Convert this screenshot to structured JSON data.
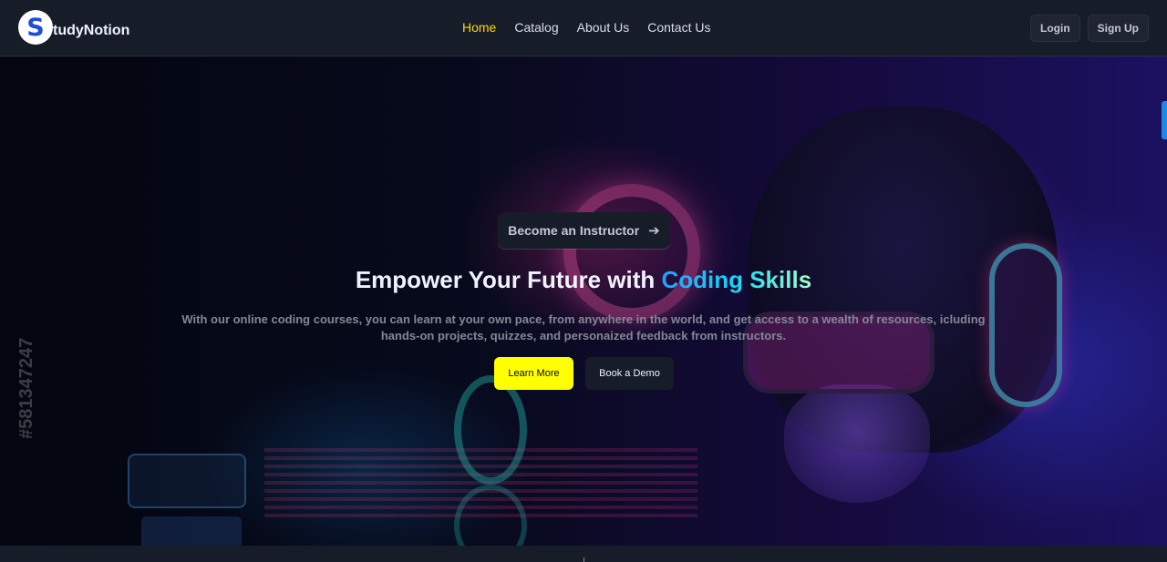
{
  "brand": {
    "logo_letter": "S",
    "name": "tudyNotion"
  },
  "nav": {
    "links": [
      {
        "label": "Home",
        "active": true
      },
      {
        "label": "Catalog",
        "active": false
      },
      {
        "label": "About Us",
        "active": false
      },
      {
        "label": "Contact Us",
        "active": false
      }
    ],
    "login_label": "Login",
    "signup_label": "Sign Up"
  },
  "hero": {
    "instructor_button_label": "Become an Instructor",
    "arrow_icon": "arrow-right-icon",
    "headline_prefix": "Empower Your Future with ",
    "headline_highlight": "Coding Skills",
    "subtext": "With our online coding courses, you can learn at your own pace, from anywhere in the world, and get access to a wealth of resources, icluding hands-on projects, quizzes, and personaized feedback from instructors.",
    "primary_cta": "Learn More",
    "secondary_cta": "Book a Demo",
    "watermark_text": "#581347247"
  },
  "colors": {
    "accent": "#ffd60a",
    "cta_primary": "#ffff00",
    "nav_bg": "#161d29",
    "highlight": "#12d8fa"
  }
}
